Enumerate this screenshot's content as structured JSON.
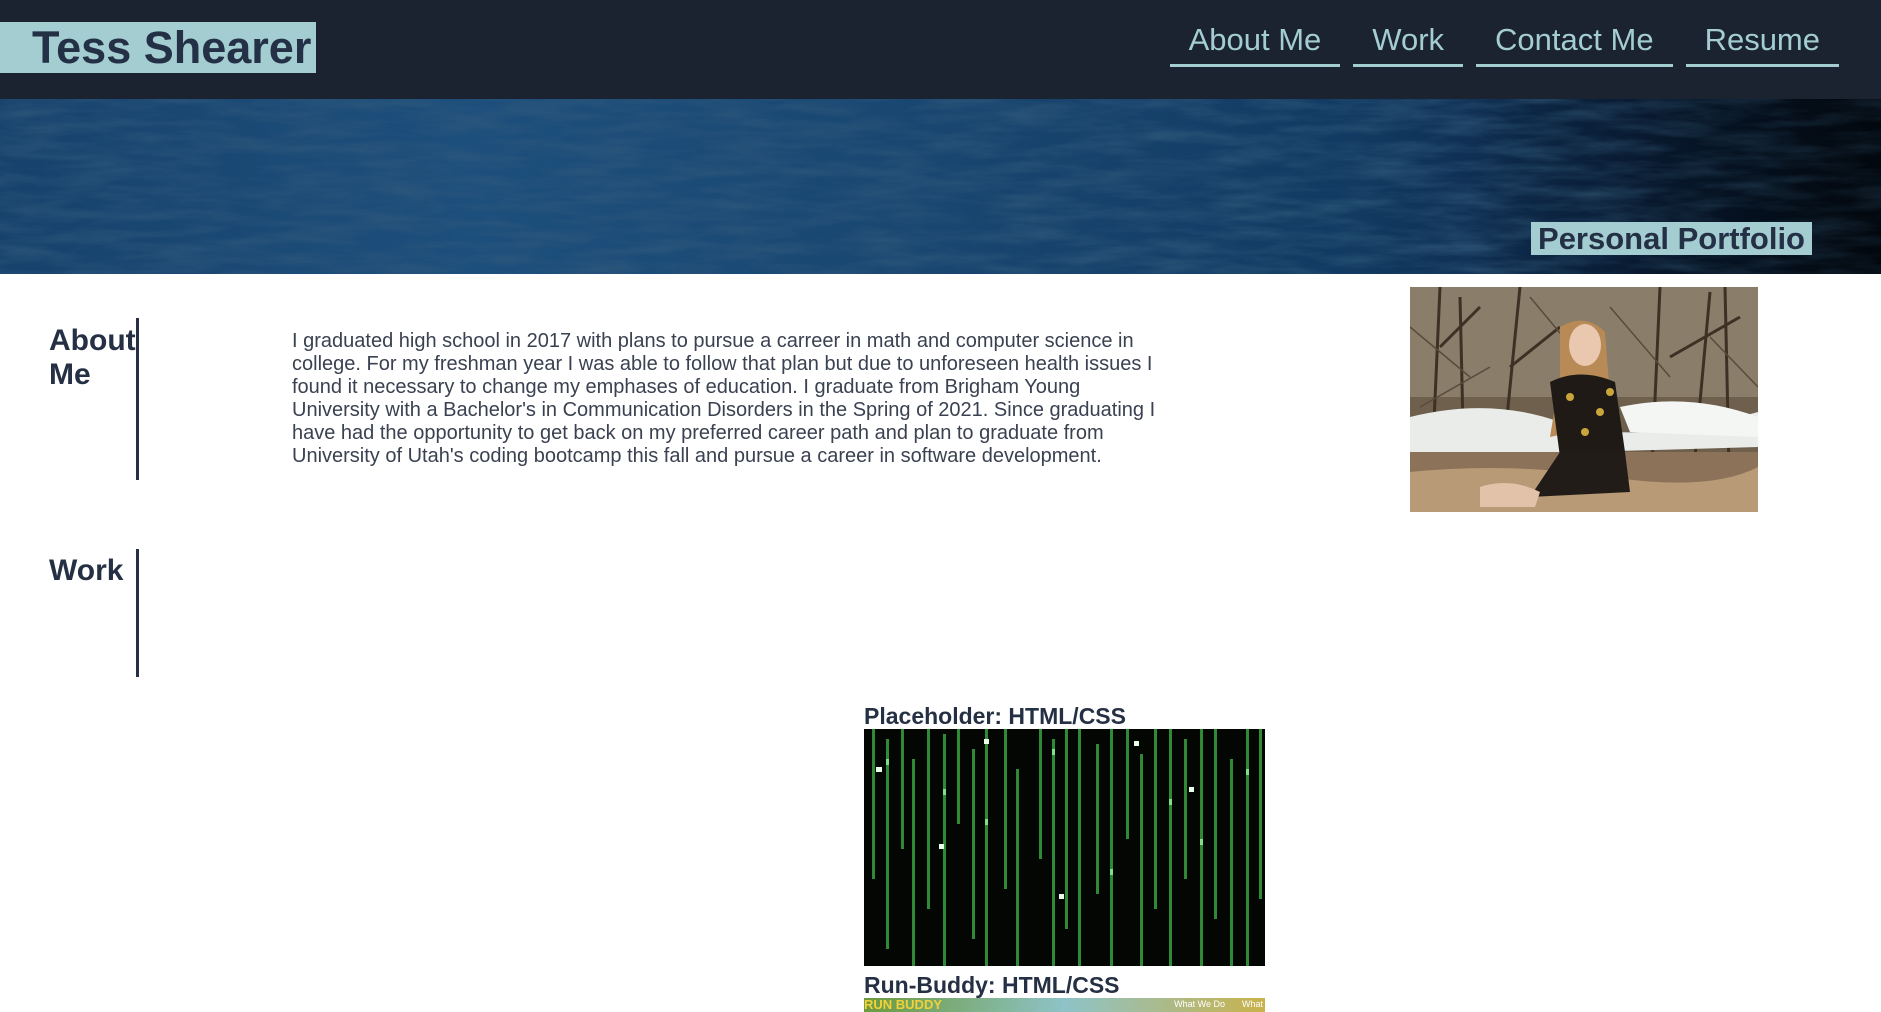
{
  "header": {
    "site_title": "Tess Shearer",
    "nav": [
      "About Me",
      "Work",
      "Contact Me",
      "Resume"
    ]
  },
  "hero": {
    "badge": "Personal Portfolio"
  },
  "about": {
    "heading_line1": "About",
    "heading_line2": "Me",
    "lines": [
      "I graduated high school in 2017 with plans to pursue a carreer in math and computer science in",
      "college. For my freshman year I was able to follow that plan but due to unforeseen health issues I",
      "found it necessary to change my emphases of education. I graduate from Brigham Young",
      "University with a Bachelor's in Communication Disorders in the Spring of 2021. Since graduating I",
      "have had the opportunity to get back on my preferred career path and plan to graduate from",
      "University of Utah's coding bootcamp this fall and pursue a career in software development."
    ]
  },
  "work": {
    "heading": "Work",
    "projects": [
      {
        "title": "Placeholder: HTML/CSS"
      },
      {
        "title": "Run-Buddy: HTML/CSS",
        "thumb_text": "RUN BUDDY",
        "thumb_nav": [
          "What We Do",
          "What"
        ]
      }
    ]
  },
  "colors": {
    "header_bg": "#1b2230",
    "accent": "#a3cdd0",
    "text_dark": "#253044",
    "hero_blue": "#1d4f7c"
  }
}
